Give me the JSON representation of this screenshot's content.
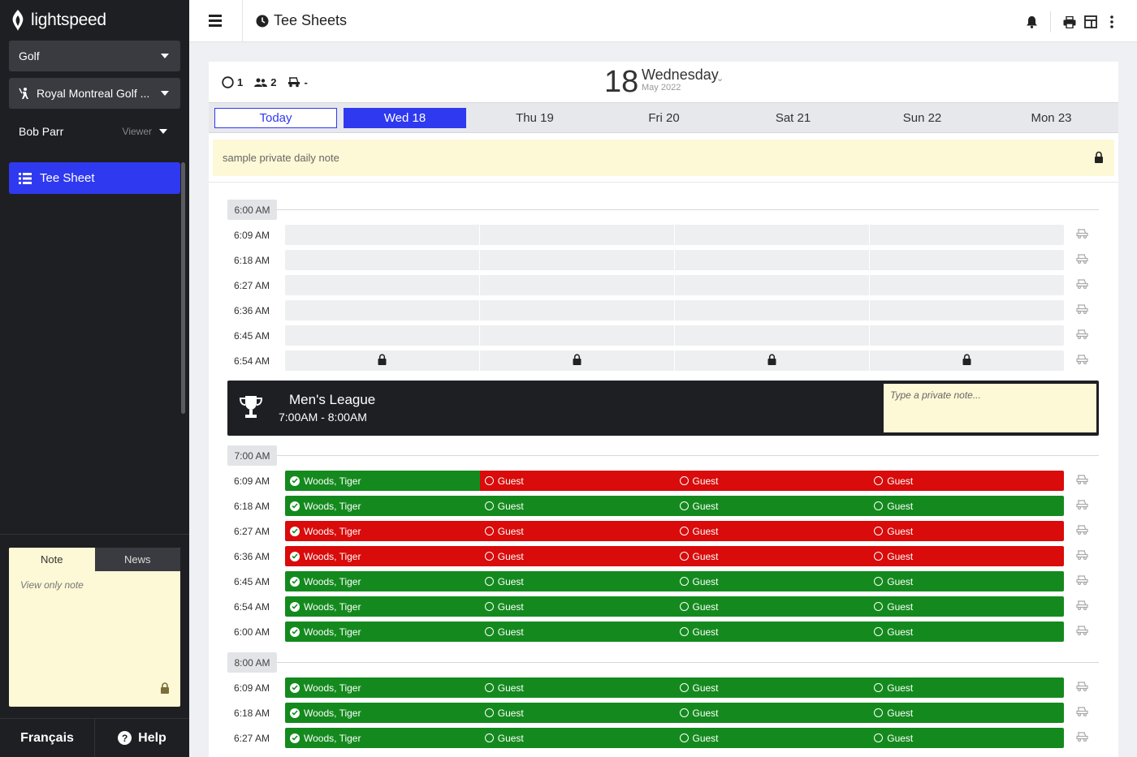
{
  "brand": {
    "name": "lightspeed"
  },
  "sidebar": {
    "module_select": "Golf",
    "course_select": "Royal Montreal Golf ...",
    "user_name": "Bob Parr",
    "user_role": "Viewer",
    "nav_active": "Tee Sheet",
    "note_tabs": {
      "note": "Note",
      "news": "News"
    },
    "note_text": "View only note",
    "footer": {
      "language": "Français",
      "help": "Help"
    }
  },
  "topbar": {
    "title": "Tee Sheets"
  },
  "header": {
    "counts": {
      "circle": "1",
      "players": "2",
      "carts": "-"
    },
    "date_number": "18",
    "day_name": "Wednesday",
    "month_year": "May 2022"
  },
  "days": [
    {
      "label": "Today",
      "state": "today"
    },
    {
      "label": "Wed 18",
      "state": "selected"
    },
    {
      "label": "Thu 19",
      "state": ""
    },
    {
      "label": "Fri 20",
      "state": ""
    },
    {
      "label": "Sat 21",
      "state": ""
    },
    {
      "label": "Sun 22",
      "state": ""
    },
    {
      "label": "Mon 23",
      "state": ""
    }
  ],
  "daily_note": "sample private daily note",
  "sections": [
    {
      "badge": "6:00 AM",
      "rows": [
        {
          "time": "6:09 AM",
          "type": "empty",
          "locked": false
        },
        {
          "time": "6:18 AM",
          "type": "empty",
          "locked": false
        },
        {
          "time": "6:27 AM",
          "type": "empty",
          "locked": false
        },
        {
          "time": "6:36 AM",
          "type": "empty",
          "locked": false
        },
        {
          "time": "6:45 AM",
          "type": "empty",
          "locked": false
        },
        {
          "time": "6:54 AM",
          "type": "empty",
          "locked": true
        }
      ]
    },
    {
      "badge": "7:00 AM",
      "rows": [
        {
          "time": "6:09 AM",
          "type": "booked",
          "colors": [
            "g",
            "r",
            "r",
            "r"
          ]
        },
        {
          "time": "6:18 AM",
          "type": "booked",
          "colors": [
            "g",
            "g",
            "g",
            "g"
          ]
        },
        {
          "time": "6:27 AM",
          "type": "booked",
          "colors": [
            "r",
            "r",
            "r",
            "r"
          ]
        },
        {
          "time": "6:36 AM",
          "type": "booked",
          "colors": [
            "r",
            "r",
            "r",
            "r"
          ]
        },
        {
          "time": "6:45 AM",
          "type": "booked",
          "colors": [
            "g",
            "g",
            "g",
            "g"
          ]
        },
        {
          "time": "6:54 AM",
          "type": "booked",
          "colors": [
            "g",
            "g",
            "g",
            "g"
          ]
        },
        {
          "time": "6:00 AM",
          "type": "booked",
          "colors": [
            "g",
            "g",
            "g",
            "g"
          ]
        }
      ]
    },
    {
      "badge": "8:00 AM",
      "rows": [
        {
          "time": "6:09 AM",
          "type": "booked",
          "colors": [
            "g",
            "g",
            "g",
            "g"
          ]
        },
        {
          "time": "6:18 AM",
          "type": "booked",
          "colors": [
            "g",
            "g",
            "g",
            "g"
          ]
        },
        {
          "time": "6:27 AM",
          "type": "booked",
          "colors": [
            "g",
            "g",
            "g",
            "g"
          ]
        }
      ]
    }
  ],
  "player_name": "Woods, Tiger",
  "guest_label": "Guest",
  "league": {
    "name": "Men's League",
    "time": "7:00AM - 8:00AM",
    "note_placeholder": "Type a private note..."
  },
  "colors": {
    "accent": "#2f39f0",
    "green": "#148a1e",
    "red": "#d90b0b",
    "note": "#fdf8d5"
  }
}
